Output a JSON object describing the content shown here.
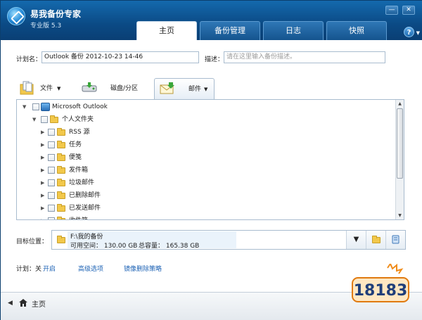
{
  "app": {
    "title": "易我备份专家",
    "version": "专业版 5.3"
  },
  "tabs": [
    "主页",
    "备份管理",
    "日志",
    "快照"
  ],
  "plan_name": {
    "label": "计划名：",
    "value": "Outlook 备份 2012-10-23 14-46"
  },
  "description": {
    "label": "描述：",
    "placeholder": "请在这里输入备份描述。"
  },
  "sources": [
    "文件",
    "磁盘/分区",
    "邮件"
  ],
  "tree": {
    "root": "Microsoft Outlook",
    "personal": "个人文件夹",
    "items": [
      "RSS 源",
      "任务",
      "便笺",
      "发件箱",
      "垃圾邮件",
      "已删除邮件",
      "已发送邮件",
      "收件箱"
    ]
  },
  "destination": {
    "label": "目标位置：",
    "path": "F:\\我的备份",
    "free": "可用空间：  130.00 GB",
    "total": "总容量：  165.38 GB"
  },
  "plan": {
    "label": "计划：关",
    "enable": "开启",
    "advanced": "高级选项",
    "mirror": "镜像删除策略"
  },
  "status": {
    "home": "主页"
  },
  "watermark": "18183"
}
